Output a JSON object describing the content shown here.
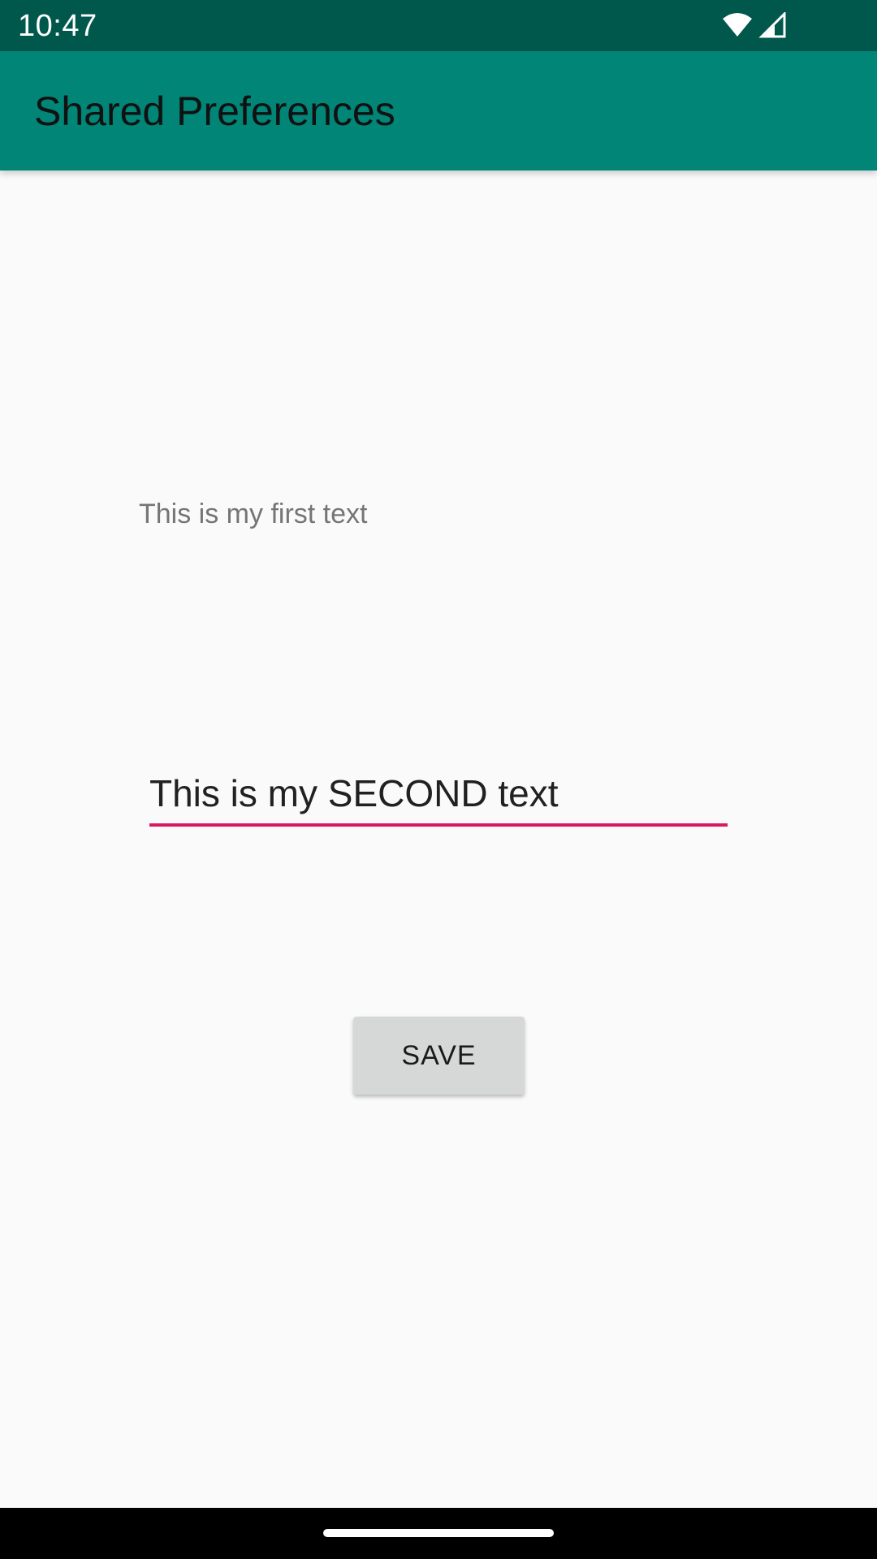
{
  "status_bar": {
    "time": "10:47",
    "icons": [
      "wifi-icon",
      "signal-icon"
    ]
  },
  "app_bar": {
    "title": "Shared Preferences"
  },
  "main": {
    "first_text": "This is my first text",
    "edit_value": "This is my SECOND text",
    "save_label": "SAVE"
  },
  "colors": {
    "status_bar": "#00574b",
    "app_bar": "#008577",
    "accent": "#d81b60",
    "background": "#fafafa",
    "button": "#d6d7d7"
  }
}
